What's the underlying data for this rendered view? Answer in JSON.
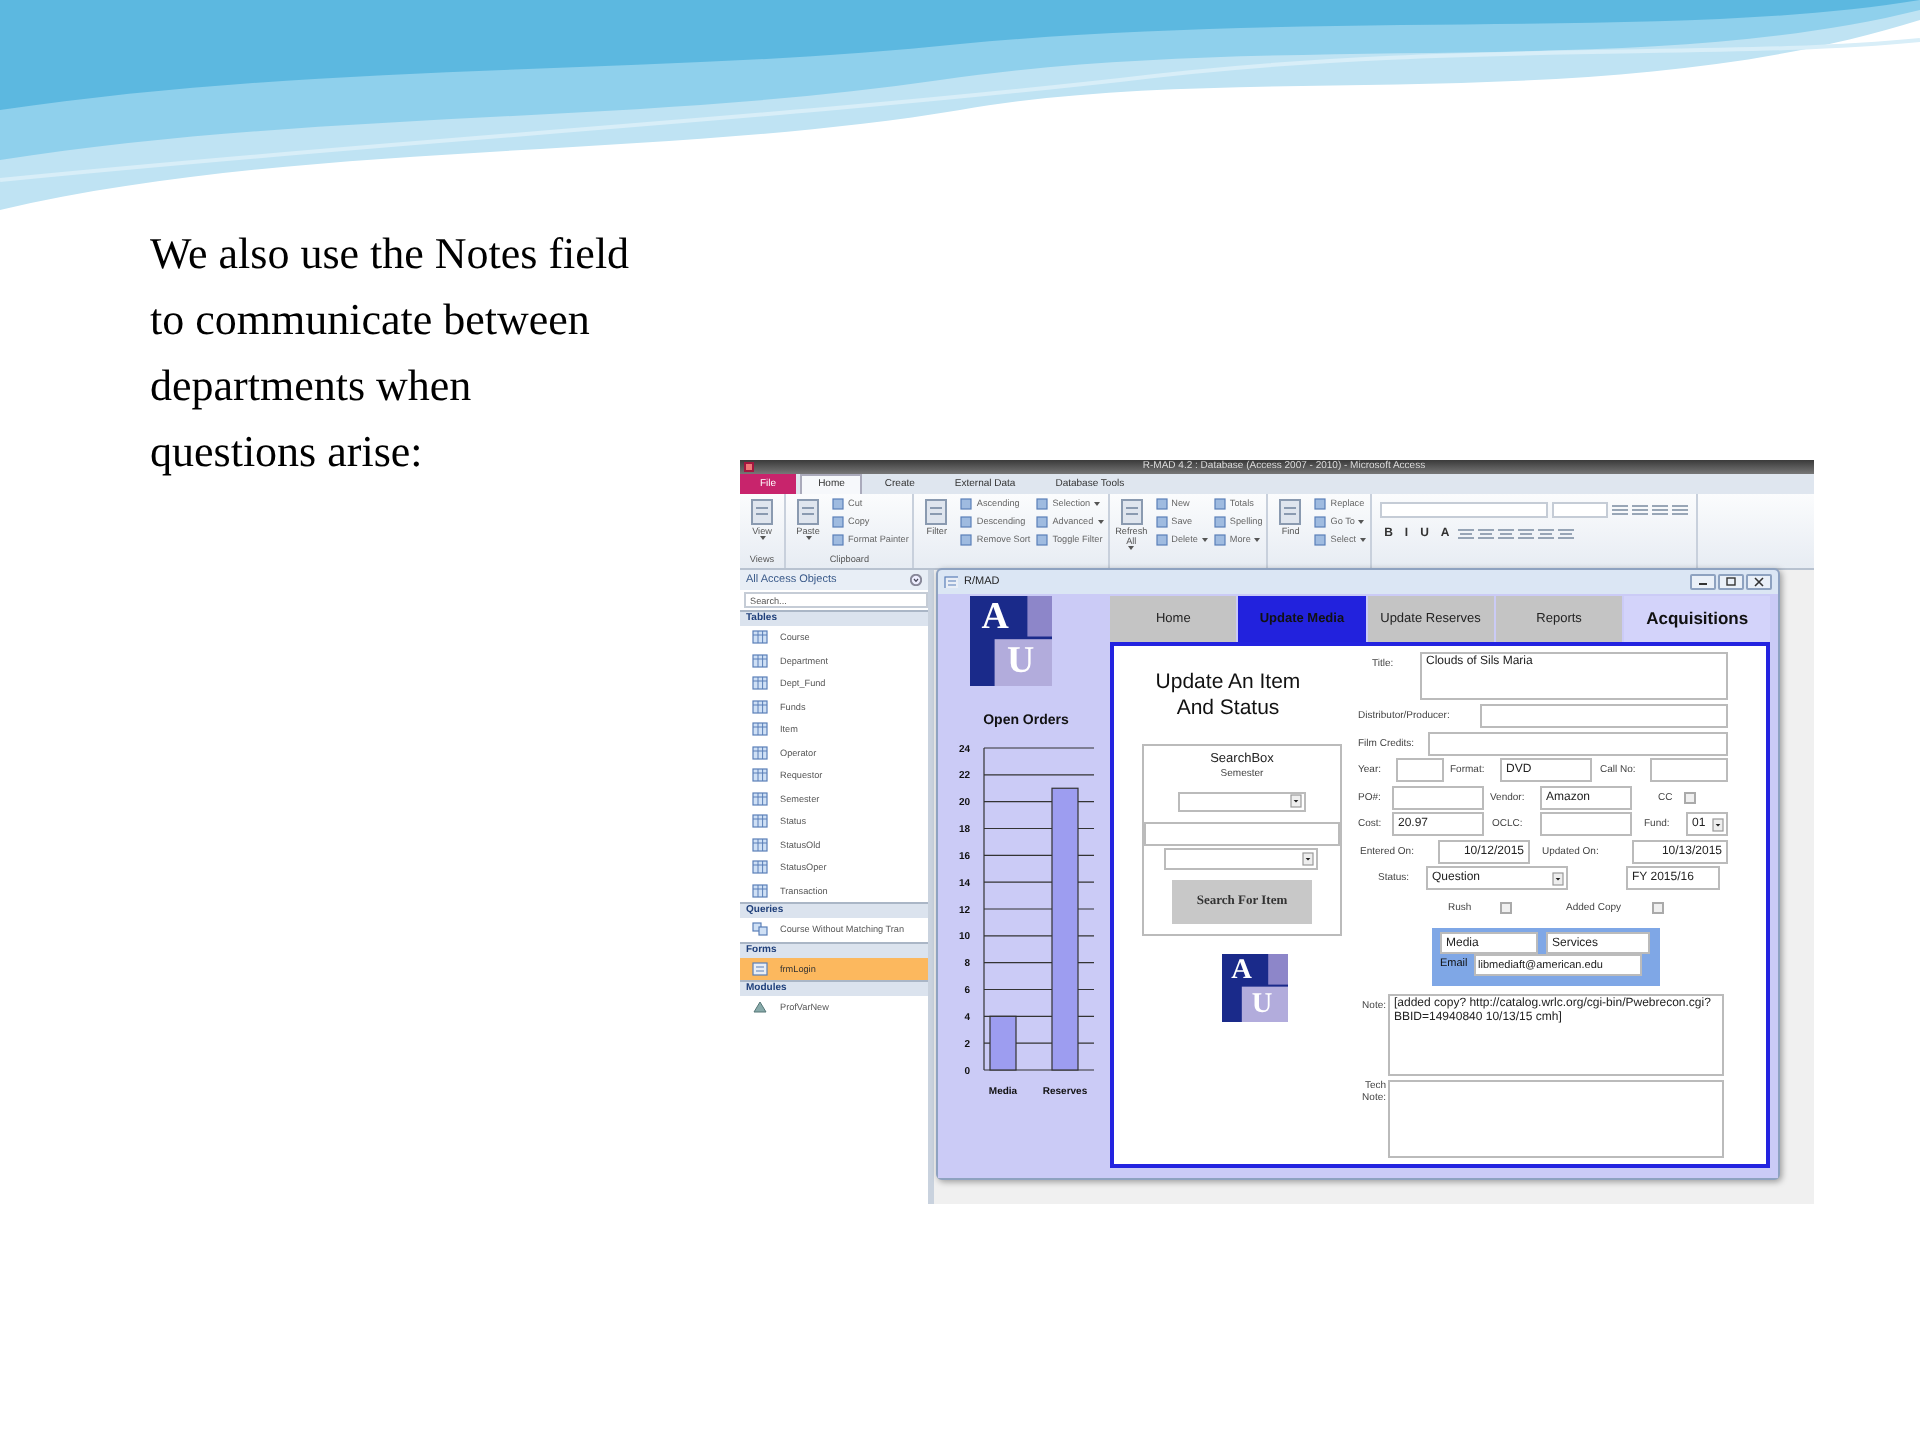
{
  "slide": {
    "text": "We also use the Notes field to communicate between departments when questions arise:"
  },
  "access_window": {
    "title": "R-MAD 4.2 : Database (Access 2007 - 2010) - Microsoft Access",
    "ribbon_tabs": [
      {
        "label": "File",
        "kind": "file",
        "selected": false
      },
      {
        "label": "Home",
        "kind": "tab",
        "selected": true
      },
      {
        "label": "Create",
        "kind": "tab",
        "selected": false
      },
      {
        "label": "External Data",
        "kind": "tab",
        "selected": false
      },
      {
        "label": "Database Tools",
        "kind": "tab",
        "selected": false
      }
    ],
    "ribbon_groups": [
      {
        "label": "Views",
        "large": {
          "label": "View",
          "dropdown": true
        }
      },
      {
        "label": "Clipboard",
        "large": {
          "label": "Paste",
          "dropdown": true
        },
        "columns": [
          [
            {
              "label": "Cut",
              "dropdown": false
            },
            {
              "label": "Copy",
              "dropdown": false
            },
            {
              "label": "Format Painter",
              "dropdown": false
            }
          ]
        ]
      },
      {
        "large": {
          "label": "Filter",
          "dropdown": false
        },
        "columns": [
          [
            {
              "label": "Ascending",
              "dropdown": false
            },
            {
              "label": "Descending",
              "dropdown": false
            },
            {
              "label": "Remove Sort",
              "dropdown": false
            }
          ],
          [
            {
              "label": "Selection",
              "dropdown": true
            },
            {
              "label": "Advanced",
              "dropdown": true
            },
            {
              "label": "Toggle Filter",
              "dropdown": false
            }
          ]
        ]
      },
      {
        "large": {
          "label": "Refresh All",
          "dropdown": true
        },
        "columns": [
          [
            {
              "label": "New",
              "dropdown": false
            },
            {
              "label": "Save",
              "dropdown": false
            },
            {
              "label": "Delete",
              "dropdown": true
            }
          ],
          [
            {
              "label": "Totals",
              "dropdown": false
            },
            {
              "label": "Spelling",
              "dropdown": false
            },
            {
              "label": "More",
              "dropdown": true
            }
          ]
        ]
      },
      {
        "large": {
          "label": "Find",
          "dropdown": false
        },
        "columns": [
          [
            {
              "label": "Replace",
              "dropdown": false
            },
            {
              "label": "Go To",
              "dropdown": true
            },
            {
              "label": "Select",
              "dropdown": true
            }
          ]
        ]
      }
    ],
    "format_buttons": [
      {
        "label": "B"
      },
      {
        "label": "I"
      },
      {
        "label": "U"
      },
      {
        "label": "A"
      }
    ],
    "nav_pane": {
      "title": "All Access Objects",
      "search": {
        "placeholder": "Search..."
      },
      "sections": [
        {
          "label": "Tables",
          "kind": "tables",
          "items": [
            {
              "label": "Course",
              "selected": false
            },
            {
              "label": "Department",
              "selected": false
            },
            {
              "label": "Dept_Fund",
              "selected": false
            },
            {
              "label": "Funds",
              "selected": false
            },
            {
              "label": "Item",
              "selected": false
            },
            {
              "label": "Operator",
              "selected": false
            },
            {
              "label": "Requestor",
              "selected": false
            },
            {
              "label": "Semester",
              "selected": false
            },
            {
              "label": "Status",
              "selected": false
            },
            {
              "label": "StatusOld",
              "selected": false
            },
            {
              "label": "StatusOper",
              "selected": false
            },
            {
              "label": "Transaction",
              "selected": false
            }
          ]
        },
        {
          "label": "Queries",
          "kind": "queries",
          "items": [
            {
              "label": "Course Without Matching Tran",
              "selected": false
            }
          ]
        },
        {
          "label": "Forms",
          "kind": "forms",
          "items": [
            {
              "label": "frmLogin",
              "selected": true
            }
          ]
        },
        {
          "label": "Modules",
          "kind": "modules",
          "items": [
            {
              "label": "ProfVarNew",
              "selected": false
            }
          ]
        }
      ]
    },
    "form": {
      "title": "R/MAD",
      "tabs": [
        {
          "label": "Home",
          "selected": false
        },
        {
          "label": "Update Media",
          "selected": true
        },
        {
          "label": "Update Reserves",
          "selected": false
        },
        {
          "label": "Reports",
          "selected": false
        }
      ],
      "header": "Acquisitions",
      "logo_letters": [
        "A",
        "U"
      ],
      "chart_data": {
        "type": "bar",
        "title": "Open Orders",
        "categories": [
          "Media",
          "Reserves"
        ],
        "values": [
          4,
          21
        ],
        "grid": true,
        "ylim": [
          0,
          24
        ],
        "yticks": [
          0,
          2,
          4,
          6,
          8,
          10,
          12,
          14,
          16,
          18,
          20,
          22,
          24
        ]
      },
      "heading": "Update An Item And Status",
      "searchbox": {
        "title": "SearchBox",
        "semester_label": "Semester",
        "button": "Search For Item"
      },
      "second_logo_letters": [
        "A",
        "U"
      ],
      "fields": {
        "title": {
          "label": "Title:",
          "value": "Clouds of Sils Maria"
        },
        "distributor": {
          "label": "Distributor/Producer:"
        },
        "film_credits": {
          "label": "Film Credits:"
        },
        "year": {
          "label": "Year:"
        },
        "format": {
          "label": "Format:",
          "value": "DVD"
        },
        "call_no": {
          "label": "Call No:"
        },
        "po": {
          "label": "PO#:"
        },
        "vendor": {
          "label": "Vendor:",
          "value": "Amazon"
        },
        "cc": {
          "label": "CC",
          "checked": false
        },
        "cost": {
          "label": "Cost:",
          "value": "20.97"
        },
        "oclc": {
          "label": "OCLC:"
        },
        "fund": {
          "label": "Fund:",
          "value": "01"
        },
        "entered_on": {
          "label": "Entered On:",
          "value": "10/12/2015"
        },
        "updated_on": {
          "label": "Updated On:",
          "value": "10/13/2015"
        },
        "status": {
          "label": "Status:",
          "value": "Question"
        },
        "fiscal_year": {
          "value": "FY 2015/16"
        },
        "rush": {
          "label": "Rush",
          "checked": false
        },
        "added_copy": {
          "label": "Added Copy",
          "checked": false
        },
        "note": {
          "label": "Note:",
          "value": "[added copy?    http://catalog.wrlc.org/cgi-bin/Pwebrecon.cgi?BBID=14940840    10/13/15 cmh]"
        },
        "tech_note": {
          "label": "Tech Note:"
        }
      },
      "contact": {
        "department": "Media",
        "unit": "Services",
        "email_label": "Email",
        "email": "libmediaft@american.edu"
      }
    }
  }
}
